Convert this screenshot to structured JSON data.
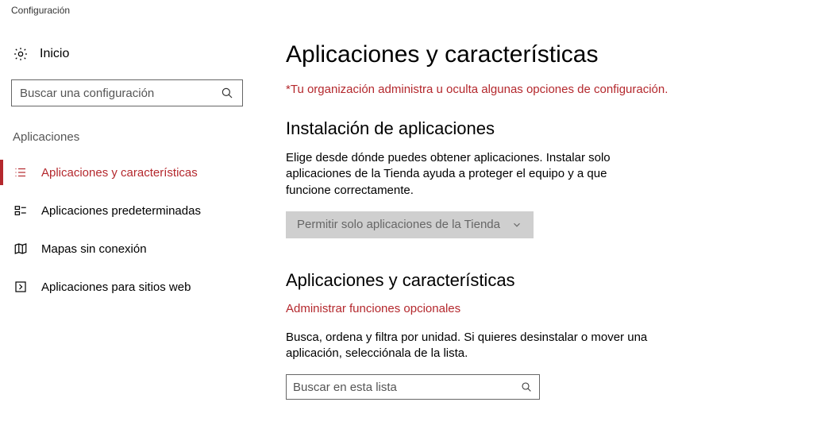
{
  "window": {
    "title": "Configuración"
  },
  "sidebar": {
    "home": "Inicio",
    "search_placeholder": "Buscar una configuración",
    "section": "Aplicaciones",
    "items": [
      {
        "label": "Aplicaciones y características",
        "active": true
      },
      {
        "label": "Aplicaciones predeterminadas"
      },
      {
        "label": "Mapas sin conexión"
      },
      {
        "label": "Aplicaciones para sitios web"
      }
    ]
  },
  "main": {
    "title": "Aplicaciones y características",
    "org_note": "*Tu organización administra u oculta algunas opciones de configuración.",
    "install": {
      "heading": "Instalación de aplicaciones",
      "description": "Elige desde dónde puedes obtener aplicaciones. Instalar solo aplicaciones de la Tienda ayuda a proteger el equipo y a que funcione correctamente.",
      "dropdown": "Permitir solo aplicaciones de la Tienda"
    },
    "features": {
      "heading": "Aplicaciones y características",
      "link": "Administrar funciones opcionales",
      "description": "Busca, ordena y filtra por unidad. Si quieres desinstalar o mover una aplicación, selecciónala de la lista.",
      "search_placeholder": "Buscar en esta lista"
    }
  }
}
